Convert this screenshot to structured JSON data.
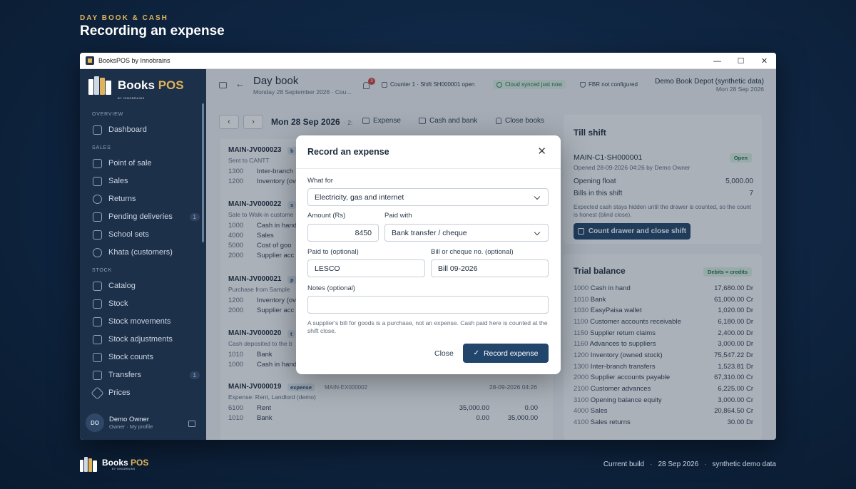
{
  "hero": {
    "eyebrow": "DAY BOOK & CASH",
    "title": "Recording an expense"
  },
  "window": {
    "title": "BooksPOS by Innobrains",
    "minimize": "—",
    "maximize": "☐",
    "close": "✕"
  },
  "sidebar": {
    "logo_text_a": "Books ",
    "logo_text_b": "POS",
    "logo_sub": "BY INNOBRAINS",
    "sections": {
      "overview": "OVERVIEW",
      "sales": "SALES",
      "stock": "STOCK"
    },
    "items": {
      "dashboard": "Dashboard",
      "pos": "Point of sale",
      "sales": "Sales",
      "returns": "Returns",
      "pending": "Pending deliveries",
      "pending_count": "1",
      "school": "School sets",
      "khata": "Khata (customers)",
      "catalog": "Catalog",
      "stock": "Stock",
      "movements": "Stock movements",
      "adjustments": "Stock adjustments",
      "counts": "Stock counts",
      "transfers": "Transfers",
      "transfers_count": "1",
      "prices": "Prices"
    },
    "user": {
      "initials": "DO",
      "name": "Demo Owner",
      "sub": "Owner · My profile"
    }
  },
  "topbar": {
    "title": "Day book",
    "subtitle": "Monday 28 September 2026 · Cou...",
    "notif_count": "3",
    "counter": "Counter 1 · Shift SH000001 open",
    "sync": "Cloud synced just now",
    "fbr": "FBR not configured",
    "store_name": "Demo Book Depot (synthetic data)",
    "store_date": "Mon 28 Sep 2026"
  },
  "toolbar": {
    "prev": "‹",
    "next": "›",
    "date": "Mon 28 Sep 2026",
    "date_suffix": "· 2:",
    "expense": "Expense",
    "cash_bank": "Cash and bank",
    "close_books": "Close books"
  },
  "journal": [
    {
      "no": "MAIN-JV000023",
      "tag": "b",
      "desc": "Sent to CANTT",
      "lines": [
        {
          "acc": "1300",
          "name": "Inter-branch",
          "dr": "",
          "cr": ""
        },
        {
          "acc": "1200",
          "name": "Inventory (ov",
          "dr": "",
          "cr": ""
        }
      ]
    },
    {
      "no": "MAIN-JV000022",
      "tag": "s",
      "desc": "Sale to Walk-in custome",
      "lines": [
        {
          "acc": "1000",
          "name": "Cash in hand",
          "dr": "",
          "cr": ""
        },
        {
          "acc": "4000",
          "name": "Sales",
          "dr": "",
          "cr": ""
        },
        {
          "acc": "5000",
          "name": "Cost of goo",
          "dr": "",
          "cr": ""
        },
        {
          "acc": "2000",
          "name": "Supplier acc",
          "dr": "",
          "cr": ""
        }
      ]
    },
    {
      "no": "MAIN-JV000021",
      "tag": "p",
      "desc": "Purchase from Sample",
      "lines": [
        {
          "acc": "1200",
          "name": "Inventory (ov",
          "dr": "",
          "cr": ""
        },
        {
          "acc": "2000",
          "name": "Supplier acc",
          "dr": "",
          "cr": ""
        }
      ]
    },
    {
      "no": "MAIN-JV000020",
      "tag": "t",
      "desc": "Cash deposited to the b",
      "lines": [
        {
          "acc": "1010",
          "name": "Bank",
          "dr": "",
          "cr": ""
        },
        {
          "acc": "1000",
          "name": "Cash in hand",
          "dr": "",
          "cr": ""
        }
      ]
    },
    {
      "no": "MAIN-JV000019",
      "tag": "expense",
      "ref": "MAIN-EX000002",
      "date": "28-09-2026 04:26",
      "desc": "Expense: Rent, Landlord (demo)",
      "lines": [
        {
          "acc": "6100",
          "name": "Rent",
          "dr": "35,000.00",
          "cr": "0.00"
        },
        {
          "acc": "1010",
          "name": "Bank",
          "dr": "0.00",
          "cr": "35,000.00"
        }
      ]
    }
  ],
  "till": {
    "title": "Till shift",
    "status": "Open",
    "shift_no": "MAIN-C1-SH000001",
    "opened": "Opened 28-09-2026 04:26 by Demo Owner",
    "float_label": "Opening float",
    "float_value": "5,000.00",
    "bills_label": "Bills in this shift",
    "bills_value": "7",
    "note": "Expected cash stays hidden until the drawer is counted, so the count is honest (blind close).",
    "button": "Count drawer and close shift"
  },
  "trial": {
    "title": "Trial balance",
    "badge": "Debits = credits",
    "rows": [
      {
        "code": "1000",
        "name": "Cash in hand",
        "amt": "17,680.00 Dr"
      },
      {
        "code": "1010",
        "name": "Bank",
        "amt": "61,000.00 Cr"
      },
      {
        "code": "1030",
        "name": "EasyPaisa wallet",
        "amt": "1,020.00 Dr"
      },
      {
        "code": "1100",
        "name": "Customer accounts receivable",
        "amt": "6,180.00 Dr"
      },
      {
        "code": "1150",
        "name": "Supplier return claims",
        "amt": "2,400.00 Dr"
      },
      {
        "code": "1160",
        "name": "Advances to suppliers",
        "amt": "3,000.00 Dr"
      },
      {
        "code": "1200",
        "name": "Inventory (owned stock)",
        "amt": "75,547.22 Dr"
      },
      {
        "code": "1300",
        "name": "Inter-branch transfers",
        "amt": "1,523.81 Dr"
      },
      {
        "code": "2000",
        "name": "Supplier accounts payable",
        "amt": "67,310.00 Cr"
      },
      {
        "code": "2100",
        "name": "Customer advances",
        "amt": "6,225.00 Cr"
      },
      {
        "code": "3100",
        "name": "Opening balance equity",
        "amt": "3,000.00 Cr"
      },
      {
        "code": "4000",
        "name": "Sales",
        "amt": "20,864.50 Cr"
      },
      {
        "code": "4100",
        "name": "Sales returns",
        "amt": "30.00 Dr"
      }
    ]
  },
  "modal": {
    "title": "Record an expense",
    "close": "✕",
    "what_for_label": "What for",
    "what_for_value": "Electricity, gas and internet",
    "amount_label": "Amount (Rs)",
    "amount_value": "8450",
    "paid_with_label": "Paid with",
    "paid_with_value": "Bank transfer / cheque",
    "paid_to_label": "Paid to (optional)",
    "paid_to_value": "LESCO",
    "bill_label": "Bill or cheque no. (optional)",
    "bill_value": "Bill 09-2026",
    "notes_label": "Notes (optional)",
    "notes_value": "",
    "hint": "A supplier's bill for goods is a purchase, not an expense. Cash paid here is counted at the shift close.",
    "cancel": "Close",
    "submit": "Record expense"
  },
  "footer": {
    "brand_a": "Books ",
    "brand_b": "POS",
    "brand_sub": "BY INNOBRAINS",
    "build": "Current build",
    "date": "28 Sep 2026",
    "data": "synthetic demo data"
  },
  "colors": {
    "sidebar": "#1d3049",
    "accent": "#21456b",
    "gold": "#e0b35a",
    "success": "#2e8a57"
  }
}
